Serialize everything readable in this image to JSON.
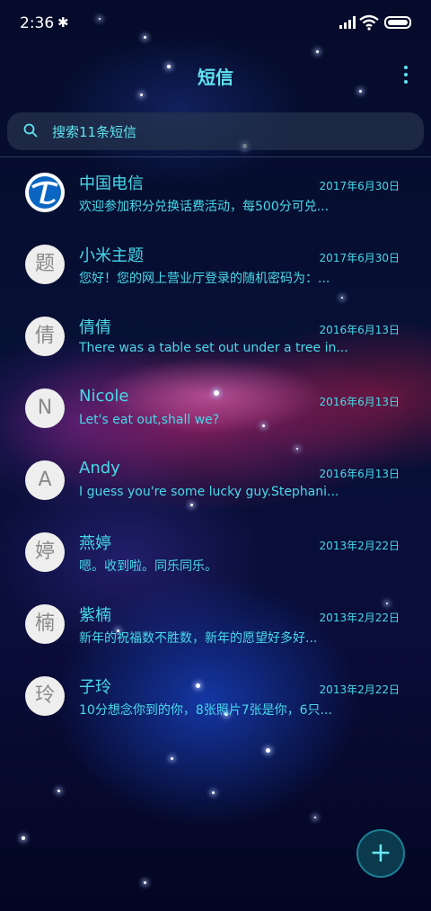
{
  "status_bar": {
    "time": "2:36",
    "bluetooth_icon": "bluetooth-icon",
    "signal_icon": "signal-icon",
    "wifi_icon": "wifi-icon",
    "battery_icon": "battery-icon"
  },
  "header": {
    "title": "短信",
    "more_icon": "more-vertical-icon"
  },
  "search": {
    "placeholder": "搜索11条短信",
    "icon": "search-icon"
  },
  "colors": {
    "accent": "#47d9ea",
    "avatar_bg": "#eeeeee",
    "fab_bg": "#0a3a4c"
  },
  "conversations": [
    {
      "avatar": "",
      "avatar_icon": "china-telecom-logo",
      "name": "中国电信",
      "date": "2017年6月30日",
      "preview": "欢迎参加积分兑换话费活动，每500分可兑..."
    },
    {
      "avatar": "题",
      "name": "小米主题",
      "date": "2017年6月30日",
      "preview": "您好！您的网上营业厅登录的随机密码为：..."
    },
    {
      "avatar": "倩",
      "name": "倩倩",
      "date": "2016年6月13日",
      "preview": "There was a table set out under a tree in..."
    },
    {
      "avatar": "N",
      "name": "Nicole",
      "date": "2016年6月13日",
      "preview": "Let's eat out,shall we?"
    },
    {
      "avatar": "A",
      "name": "Andy",
      "date": "2016年6月13日",
      "preview": "I guess you're some lucky guy.Stephani..."
    },
    {
      "avatar": "婷",
      "name": "燕婷",
      "date": "2013年2月22日",
      "preview": "嗯。收到啦。同乐同乐。"
    },
    {
      "avatar": "楠",
      "name": "紫楠",
      "date": "2013年2月22日",
      "preview": "新年的祝福数不胜数，新年的愿望好多好..."
    },
    {
      "avatar": "玲",
      "name": "子玲",
      "date": "2013年2月22日",
      "preview": "10分想念你到的你，8张照片7张是你，6只..."
    }
  ],
  "fab": {
    "label": "+",
    "icon": "add-icon"
  }
}
